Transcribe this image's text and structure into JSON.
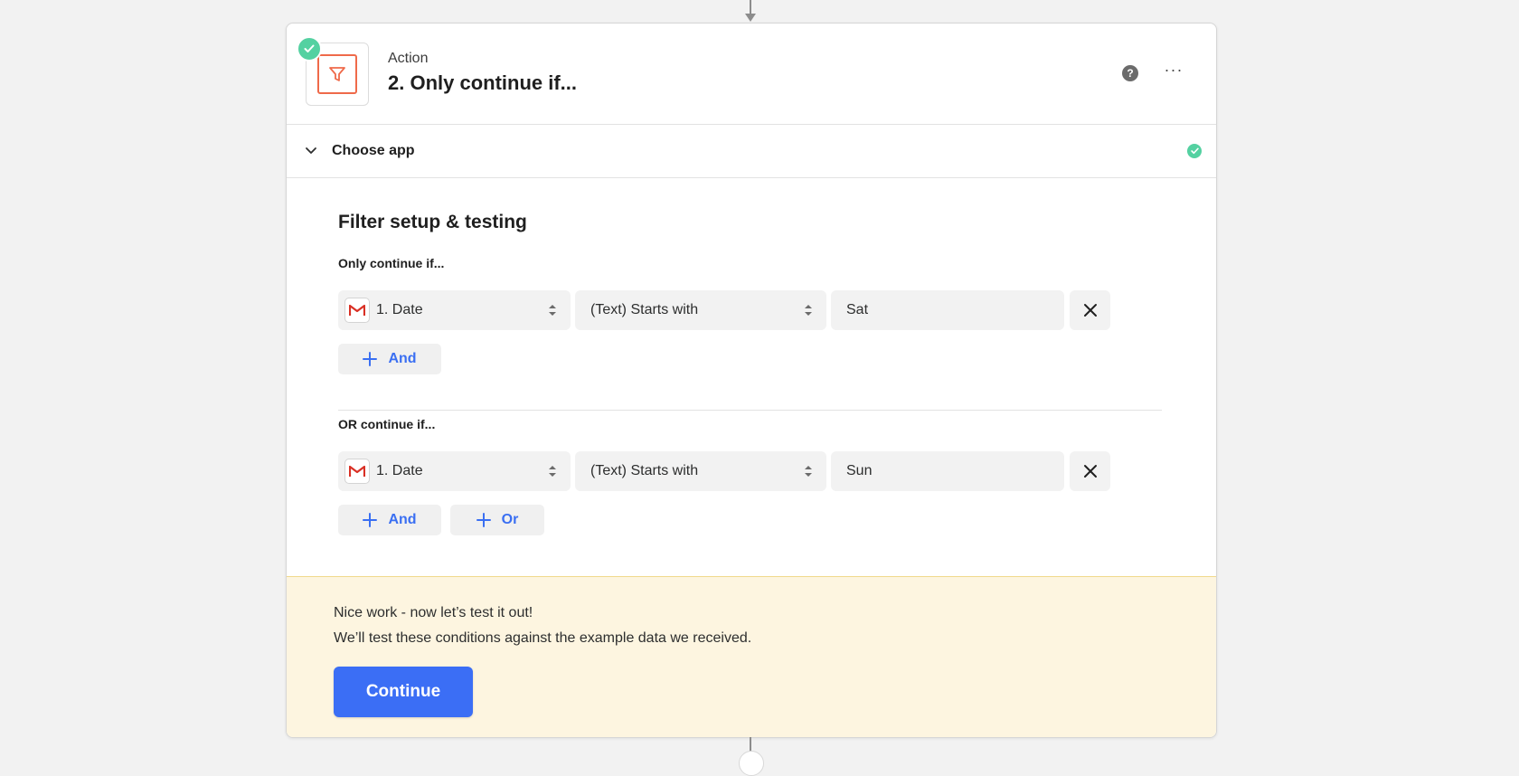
{
  "step": {
    "type_label": "Action",
    "title": "2. Only continue if...",
    "icon": "filter-icon",
    "help_glyph": "?",
    "more_glyph": "···"
  },
  "choose_app": {
    "label": "Choose app"
  },
  "filter": {
    "title": "Filter setup & testing",
    "groups": [
      {
        "label": "Only continue if...",
        "condition": {
          "field": "1. Date",
          "field_app_icon": "gmail-icon",
          "operator": "(Text) Starts with",
          "value": "Sat"
        },
        "buttons": [
          "And"
        ]
      },
      {
        "label": "OR continue if...",
        "condition": {
          "field": "1. Date",
          "field_app_icon": "gmail-icon",
          "operator": "(Text) Starts with",
          "value": "Sun"
        },
        "buttons": [
          "And",
          "Or"
        ]
      }
    ]
  },
  "notice": {
    "line1": "Nice work - now let’s test it out!",
    "line2": "We’ll test these conditions against the example data we received.",
    "button": "Continue"
  },
  "colors": {
    "accent_blue": "#3b6ef5",
    "success_green": "#54d1a1",
    "filter_orange": "#ef6a4a",
    "notice_bg": "#fdf5e0"
  }
}
